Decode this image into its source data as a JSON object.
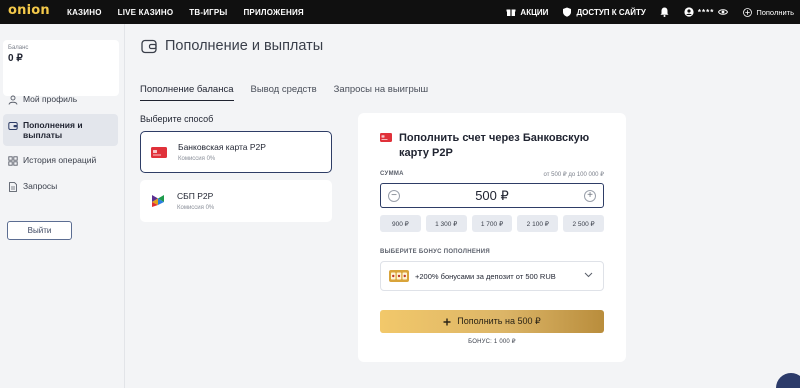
{
  "header": {
    "logo": "onion",
    "nav": [
      "КАЗИНО",
      "LIVE КАЗИНО",
      "ТВ-ИГРЫ",
      "ПРИЛОЖЕНИЯ"
    ],
    "promotions": "АКЦИИ",
    "site_access": "ДОСТУП К САЙТУ",
    "user_masked": "****",
    "replenish": "Пополнить"
  },
  "sidebar": {
    "balance_label": "Баланс",
    "balance_value": "0 ₽",
    "items": [
      {
        "label": "Мой профиль",
        "icon": "user-icon"
      },
      {
        "label": "Пополнения и выплаты",
        "icon": "wallet-icon",
        "active": true
      },
      {
        "label": "История операций",
        "icon": "grid-icon"
      },
      {
        "label": "Запросы",
        "icon": "document-icon"
      }
    ],
    "logout": "Выйти"
  },
  "main": {
    "title": "Пополнение и выплаты",
    "tabs": [
      "Пополнение баланса",
      "Вывод средств",
      "Запросы на выигрыш"
    ],
    "choose_method": "Выберите способ",
    "methods": [
      {
        "name": "Банковская карта P2P",
        "fee": "Комиссия 0%",
        "icon": "bank-card-icon",
        "selected": true
      },
      {
        "name": "СБП P2P",
        "fee": "Комиссия 0%",
        "icon": "sbp-icon"
      }
    ]
  },
  "panel": {
    "title": "Пополнить счет через Банковскую карту P2P",
    "sum_label": "СУММА",
    "sum_range": "от 500 ₽ до 100 000 ₽",
    "amount": "500 ₽",
    "quick_amounts": [
      "900 ₽",
      "1 300 ₽",
      "1 700 ₽",
      "2 100 ₽",
      "2 500 ₽"
    ],
    "bonus_label": "ВЫБЕРИТЕ БОНУС ПОПОЛНЕНИЯ",
    "bonus_selected": "+200% бонусами за депозит от 500 RUB",
    "deposit_button": "Пополнить на 500 ₽",
    "bonus_note": "БОНУС: 1 000 ₽"
  },
  "colors": {
    "accent_gold": "#dcb567",
    "brand_logo": "#f4c94a",
    "navy": "#2e3d66",
    "card_red": "#e0313a"
  }
}
